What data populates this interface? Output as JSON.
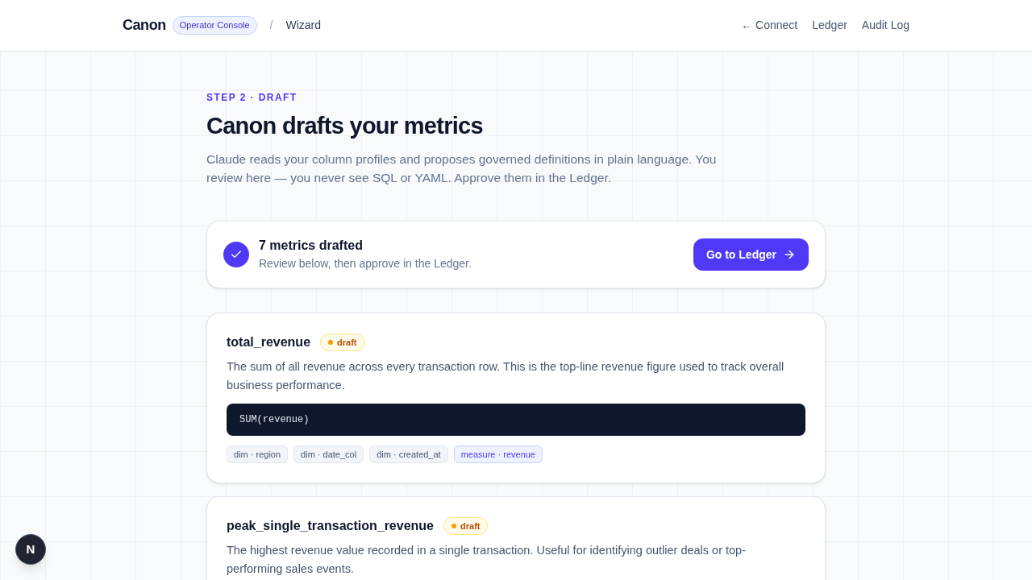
{
  "header": {
    "brand": "Canon",
    "tag": "Operator Console",
    "separator": "/",
    "breadcrumb": "Wizard",
    "nav": [
      {
        "label": "← Connect"
      },
      {
        "label": "Ledger"
      },
      {
        "label": "Audit Log"
      }
    ]
  },
  "intro": {
    "eyebrow": "STEP 2 · DRAFT",
    "title": "Canon drafts your metrics",
    "description": "Claude reads your column profiles and proposes governed definitions in plain language. You review here — you never see SQL or YAML. Approve them in the Ledger."
  },
  "summary": {
    "title": "7 metrics drafted",
    "subtitle": "Review below, then approve in the Ledger.",
    "button": "Go to Ledger"
  },
  "metrics": [
    {
      "name": "total_revenue",
      "status": {
        "kind": "draft",
        "label": "draft"
      },
      "description": "The sum of all revenue across every transaction row. This is the top-line revenue figure used to track overall business performance.",
      "expression": "SUM(revenue)",
      "tags": [
        {
          "kind": "dim",
          "label": "dim · region"
        },
        {
          "kind": "dim",
          "label": "dim · date_col"
        },
        {
          "kind": "dim",
          "label": "dim · created_at"
        },
        {
          "kind": "measure",
          "label": "measure · revenue"
        }
      ]
    },
    {
      "name": "peak_single_transaction_revenue",
      "status": {
        "kind": "draft",
        "label": "draft"
      },
      "description": "The highest revenue value recorded in a single transaction. Useful for identifying outlier deals or top-performing sales events."
    }
  ],
  "dev_badge": {
    "label": "N"
  }
}
